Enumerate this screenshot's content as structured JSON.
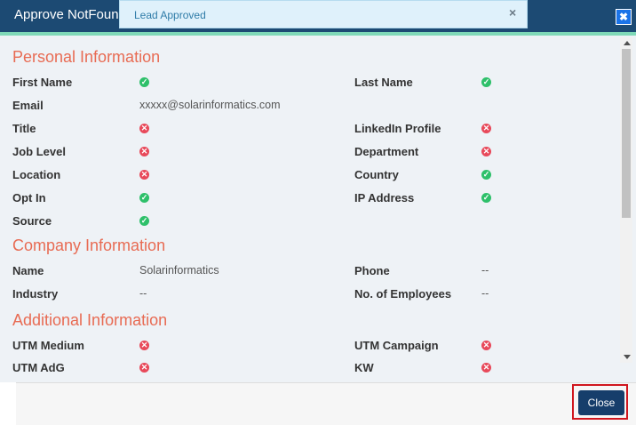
{
  "dialog": {
    "title": "Approve NotFound"
  },
  "toast": {
    "message": "Lead Approved",
    "close_glyph": "×"
  },
  "close_icon_glyph": "✖",
  "sections": {
    "personal": "Personal Information",
    "company": "Company Information",
    "additional": "Additional Information"
  },
  "personal": {
    "first_name": "First Name",
    "last_name": "Last Name",
    "email": "Email",
    "email_value": "xxxxx@solarinformatics.com",
    "title": "Title",
    "linkedin": "LinkedIn Profile",
    "job_level": "Job Level",
    "department": "Department",
    "location": "Location",
    "country": "Country",
    "opt_in": "Opt In",
    "ip_address": "IP Address",
    "source": "Source"
  },
  "company": {
    "name": "Name",
    "name_value": "Solarinformatics",
    "phone": "Phone",
    "phone_value": "--",
    "industry": "Industry",
    "industry_value": "--",
    "employees": "No. of Employees",
    "employees_value": "--"
  },
  "additional": {
    "utm_medium": "UTM Medium",
    "utm_campaign": "UTM Campaign",
    "utm_adg": "UTM AdG",
    "kw": "KW"
  },
  "status_icons": {
    "ok": "✓",
    "bad": "✕"
  },
  "colors": {
    "header": "#1c4a73",
    "section_heading": "#e86b53",
    "ok": "#2ec06a",
    "bad": "#e8495a",
    "primary_button": "#163e6b",
    "highlight": "#d0161e"
  },
  "footer": {
    "close_label": "Close"
  }
}
